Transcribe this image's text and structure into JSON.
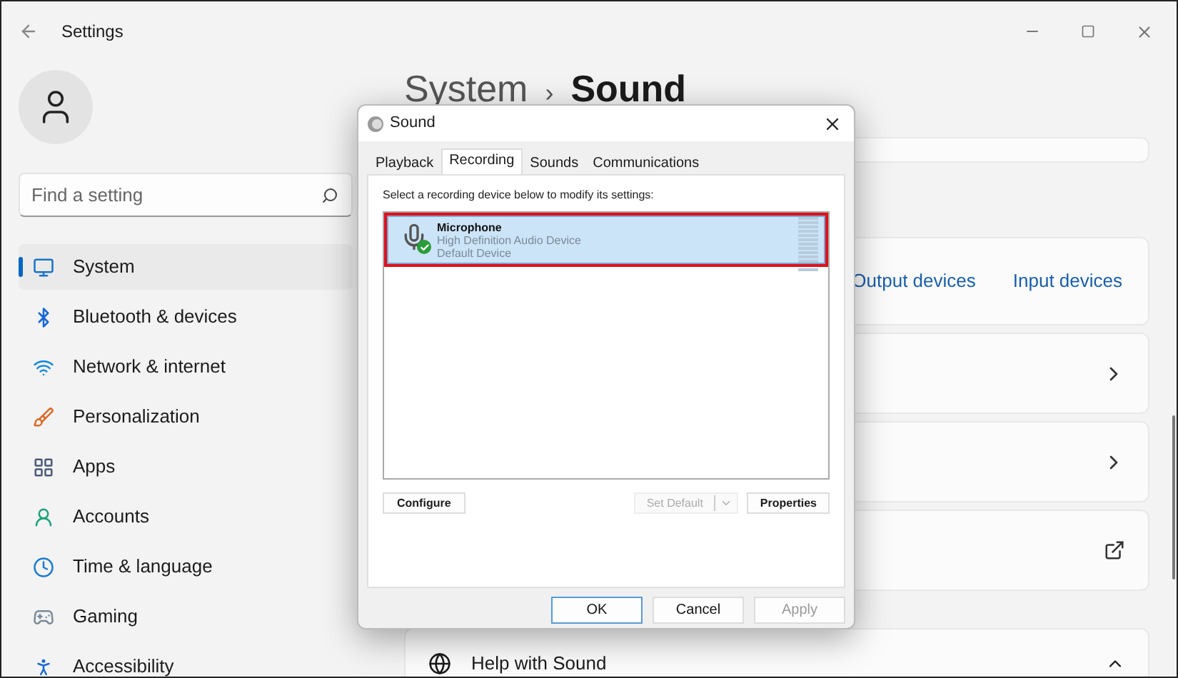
{
  "window": {
    "title": "Settings"
  },
  "search": {
    "placeholder": "Find a setting"
  },
  "nav": [
    {
      "label": "System",
      "selected": true,
      "kind": "system"
    },
    {
      "label": "Bluetooth & devices",
      "selected": false,
      "kind": "bluetooth"
    },
    {
      "label": "Network & internet",
      "selected": false,
      "kind": "network"
    },
    {
      "label": "Personalization",
      "selected": false,
      "kind": "brush"
    },
    {
      "label": "Apps",
      "selected": false,
      "kind": "apps"
    },
    {
      "label": "Accounts",
      "selected": false,
      "kind": "accounts"
    },
    {
      "label": "Time & language",
      "selected": false,
      "kind": "time"
    },
    {
      "label": "Gaming",
      "selected": false,
      "kind": "gaming"
    },
    {
      "label": "Accessibility",
      "selected": false,
      "kind": "accessibility"
    }
  ],
  "breadcrumb": {
    "parent": "System",
    "separator": "›",
    "current": "Sound"
  },
  "links": [
    "Output devices",
    "Input devices"
  ],
  "rows": [
    {
      "kind": "chevron"
    },
    {
      "kind": "chevron"
    },
    {
      "kind": "external"
    }
  ],
  "help": {
    "label": "Help with Sound"
  },
  "dialog": {
    "title": "Sound",
    "tabs": [
      {
        "label": "Playback",
        "selected": false
      },
      {
        "label": "Recording",
        "selected": true
      },
      {
        "label": "Sounds",
        "selected": false
      },
      {
        "label": "Communications",
        "selected": false
      }
    ],
    "instruction": "Select a recording device below to modify its settings:",
    "devices": [
      {
        "name": "Microphone",
        "driver": "High Definition Audio Device",
        "status": "Default Device",
        "selected": true,
        "highlighted": true
      }
    ],
    "configure": "Configure",
    "set_default": {
      "label": "Set Default",
      "disabled": true
    },
    "properties": "Properties",
    "buttons": [
      {
        "label": "OK",
        "disabled": false,
        "default": true
      },
      {
        "label": "Cancel",
        "disabled": false,
        "default": false
      },
      {
        "label": "Apply",
        "disabled": true,
        "default": false
      }
    ]
  }
}
